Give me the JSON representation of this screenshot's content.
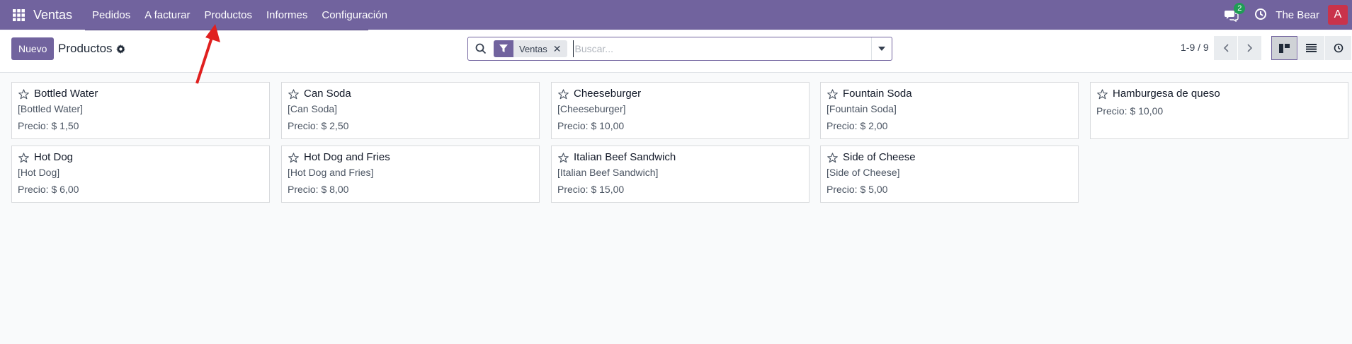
{
  "app": {
    "brand": "Ventas",
    "apps_icon": "grid-icon"
  },
  "menu": [
    "Pedidos",
    "A facturar",
    "Productos",
    "Informes",
    "Configuración"
  ],
  "systray": {
    "messages_count": "2",
    "user_name": "The Bear",
    "avatar_letter": "A"
  },
  "control_panel": {
    "new_button": "Nuevo",
    "breadcrumb": "Productos",
    "search": {
      "facet": "Ventas",
      "placeholder": "Buscar..."
    },
    "pager": "1-9 / 9"
  },
  "price_label": "Precio:",
  "products": [
    {
      "name": "Bottled Water",
      "ref": "[Bottled Water]",
      "price": "Precio: $ 1,50"
    },
    {
      "name": "Can Soda",
      "ref": "[Can Soda]",
      "price": "Precio: $ 2,50"
    },
    {
      "name": "Cheeseburger",
      "ref": "[Cheeseburger]",
      "price": "Precio: $ 10,00"
    },
    {
      "name": "Fountain Soda",
      "ref": "[Fountain Soda]",
      "price": "Precio: $ 2,00"
    },
    {
      "name": "Hamburgesa de queso",
      "ref": "",
      "price": "Precio: $ 10,00"
    },
    {
      "name": "Hot Dog",
      "ref": "[Hot Dog]",
      "price": "Precio: $ 6,00"
    },
    {
      "name": "Hot Dog and Fries",
      "ref": "[Hot Dog and Fries]",
      "price": "Precio: $ 8,00"
    },
    {
      "name": "Italian Beef Sandwich",
      "ref": "[Italian Beef Sandwich]",
      "price": "Precio: $ 15,00"
    },
    {
      "name": "Side of Cheese",
      "ref": "[Side of Cheese]",
      "price": "Precio: $ 5,00"
    }
  ],
  "colors": {
    "brand": "#71639e",
    "badge": "#1f9d55",
    "avatar": "#c9334b",
    "annotation_arrow": "#e0201f"
  }
}
